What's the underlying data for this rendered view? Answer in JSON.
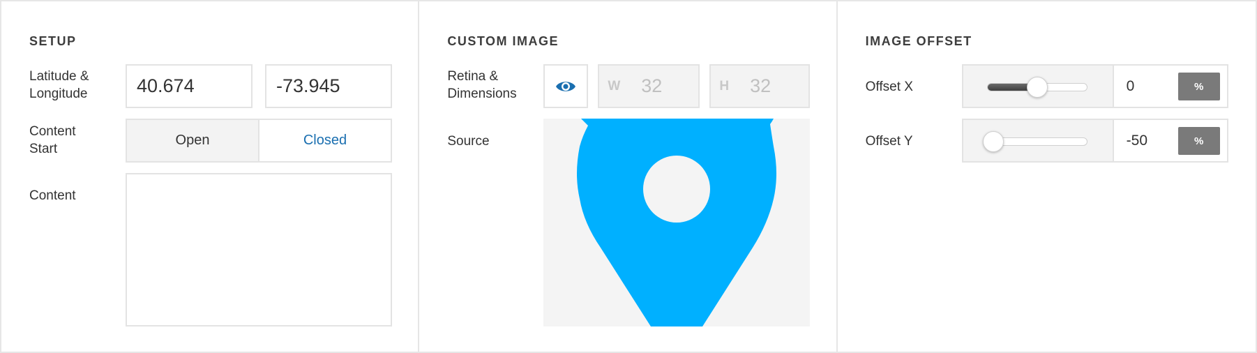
{
  "setup": {
    "title": "SETUP",
    "lat_lng_label_line1": "Latitude &",
    "lat_lng_label_line2": "Longitude",
    "latitude": "40.674",
    "longitude": "-73.945",
    "content_start_label_line1": "Content",
    "content_start_label_line2": "Start",
    "content_start_options": [
      "Open",
      "Closed"
    ],
    "content_start_selected": "Closed",
    "content_label": "Content",
    "content_value": ""
  },
  "custom_image": {
    "title": "CUSTOM IMAGE",
    "retina_label_line1": "Retina &",
    "retina_label_line2": "Dimensions",
    "retina_icon": "eye-icon",
    "width_label": "W",
    "width_value": "32",
    "height_label": "H",
    "height_value": "32",
    "source_label": "Source",
    "source_icon": "map-pin-icon",
    "pin_color": "#00b0ff"
  },
  "image_offset": {
    "title": "IMAGE OFFSET",
    "offset_x_label": "Offset X",
    "offset_x_value": "0",
    "offset_x_unit": "%",
    "offset_x_slider_fraction": 0.5,
    "offset_y_label": "Offset Y",
    "offset_y_value": "-50",
    "offset_y_unit": "%",
    "offset_y_slider_fraction": 0.0
  },
  "colors": {
    "accent": "#1a6fb0",
    "unit_button": "#7a7a7a",
    "slider_fill": "#555555"
  }
}
